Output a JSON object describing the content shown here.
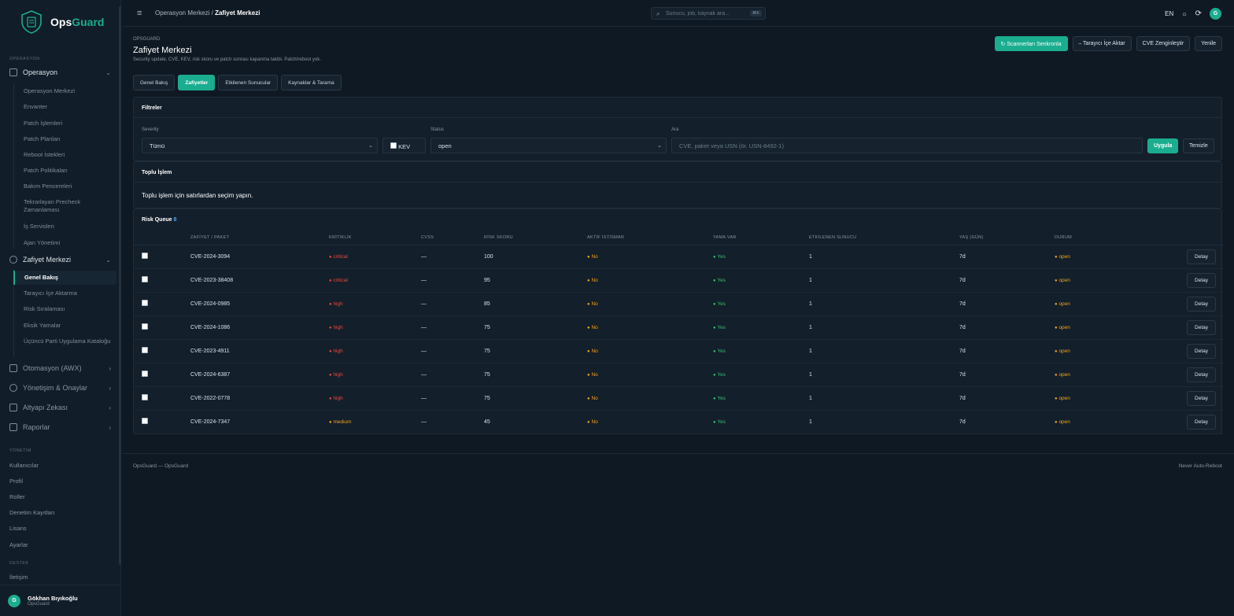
{
  "brand": {
    "name_a": "Ops",
    "name_b": "Guard"
  },
  "sidebar": {
    "section_operasyon": "OPERASYON",
    "operasyon": "Operasyon",
    "operasyon_items": [
      "Operasyon Merkezi",
      "Envanter",
      "Patch İşlemleri",
      "Patch Planları",
      "Reboot İstekleri",
      "Patch Politikaları",
      "Bakım Pencereleri",
      "Tekrarlayan Precheck Zamanlaması",
      "İş Servisleri",
      "Ajan Yönetimi"
    ],
    "zafiyet": "Zafiyet Merkezi",
    "zafiyet_items": [
      "Genel Bakış",
      "Tarayıcı İçe Aktarma",
      "Risk Sıralaması",
      "Eksik Yamalar",
      "Üçüncü Parti Uygulama Kataloğu"
    ],
    "otomasyon": "Otomasyon (AWX)",
    "yonetisim": "Yönetişim & Onaylar",
    "altyapi": "Altyapı Zekası",
    "raporlar": "Raporlar",
    "section_yonetim": "YÖNETİM",
    "yonetim_items": [
      "Kullanıcılar",
      "Profil",
      "Roller",
      "Denetim Kayıtları",
      "Lisans",
      "Ayarlar"
    ],
    "section_destek": "DESTEK",
    "destek_items": [
      "İletişim"
    ],
    "user": {
      "initial": "G",
      "name": "Gökhan Bıyıkoğlu",
      "org": "OpsGuard"
    }
  },
  "topbar": {
    "crumb_parent": "Operasyon Merkezi",
    "crumb_sep": "/",
    "crumb_current": "Zafiyet Merkezi",
    "search_placeholder": "Sunucu, job, kaynak ara...",
    "search_kbd": "⌘K",
    "lang": "EN",
    "avatar": "G"
  },
  "page": {
    "eyebrow": "OPSGUARD",
    "title": "Zafiyet Merkezi",
    "subtitle": "Security update, CVE, KEV, risk skoru ve patch sonrası kapanma takibi. Patch/reboot yok."
  },
  "actions": {
    "sync": "↻ Scannerları Senkronla",
    "import": "⎯ Tarayıcı İçe Aktar",
    "enrich": "CVE Zenginleştir",
    "refresh": "Yenile"
  },
  "tabs": [
    "Genel Bakış",
    "Zafiyetler",
    "Etkilenen Sunucular",
    "Kaynaklar & Tarama"
  ],
  "filters": {
    "title": "Filtreler",
    "severity_label": "Severity",
    "severity_value": "Tümü",
    "kev_label": "KEV",
    "status_label": "Status",
    "status_value": "open",
    "search_label": "Ara",
    "search_placeholder": "CVE, paket veya USN (ör. USN-8492-1)",
    "apply": "Uygula",
    "clear": "Temizle"
  },
  "bulk": {
    "title": "Toplu İşlem",
    "message": "Toplu işlem için satırlardan seçim yapın."
  },
  "queue": {
    "title": "Risk Queue",
    "count": "8",
    "headers": [
      "",
      "ZAFİYET / PAKET",
      "KRİTİKLİK",
      "CVSS",
      "RİSK SKORU",
      "AKTİF İSTİSMAR",
      "YAMA VAR",
      "ETKİLENEN SUNUCU",
      "YAŞ (GÜN)",
      "DURUM",
      ""
    ],
    "rows": [
      {
        "id": "CVE-2024-3094",
        "sev": "critical",
        "cvss": "—",
        "risk": "100",
        "exploit": "No",
        "patch": "Yes",
        "hosts": "1",
        "age": "7d",
        "status": "open",
        "action": "Detay"
      },
      {
        "id": "CVE-2023-38408",
        "sev": "critical",
        "cvss": "—",
        "risk": "95",
        "exploit": "No",
        "patch": "Yes",
        "hosts": "1",
        "age": "7d",
        "status": "open",
        "action": "Detay"
      },
      {
        "id": "CVE-2024-0985",
        "sev": "high",
        "cvss": "—",
        "risk": "85",
        "exploit": "No",
        "patch": "Yes",
        "hosts": "1",
        "age": "7d",
        "status": "open",
        "action": "Detay"
      },
      {
        "id": "CVE-2024-1086",
        "sev": "high",
        "cvss": "—",
        "risk": "75",
        "exploit": "No",
        "patch": "Yes",
        "hosts": "1",
        "age": "7d",
        "status": "open",
        "action": "Detay"
      },
      {
        "id": "CVE-2023-4911",
        "sev": "high",
        "cvss": "—",
        "risk": "75",
        "exploit": "No",
        "patch": "Yes",
        "hosts": "1",
        "age": "7d",
        "status": "open",
        "action": "Detay"
      },
      {
        "id": "CVE-2024-6387",
        "sev": "high",
        "cvss": "—",
        "risk": "75",
        "exploit": "No",
        "patch": "Yes",
        "hosts": "1",
        "age": "7d",
        "status": "open",
        "action": "Detay"
      },
      {
        "id": "CVE-2022-0778",
        "sev": "high",
        "cvss": "—",
        "risk": "75",
        "exploit": "No",
        "patch": "Yes",
        "hosts": "1",
        "age": "7d",
        "status": "open",
        "action": "Detay"
      },
      {
        "id": "CVE-2024-7347",
        "sev": "medium",
        "cvss": "—",
        "risk": "45",
        "exploit": "No",
        "patch": "Yes",
        "hosts": "1",
        "age": "7d",
        "status": "open",
        "action": "Detay"
      }
    ]
  },
  "footer": {
    "left": "OpsGuard — OpsGuard",
    "right": "Never Auto-Reboot"
  },
  "colors": {
    "accent": "#1aad8f",
    "critical": "#e8493d",
    "medium": "#f2a21b",
    "yes": "#34c06a"
  }
}
